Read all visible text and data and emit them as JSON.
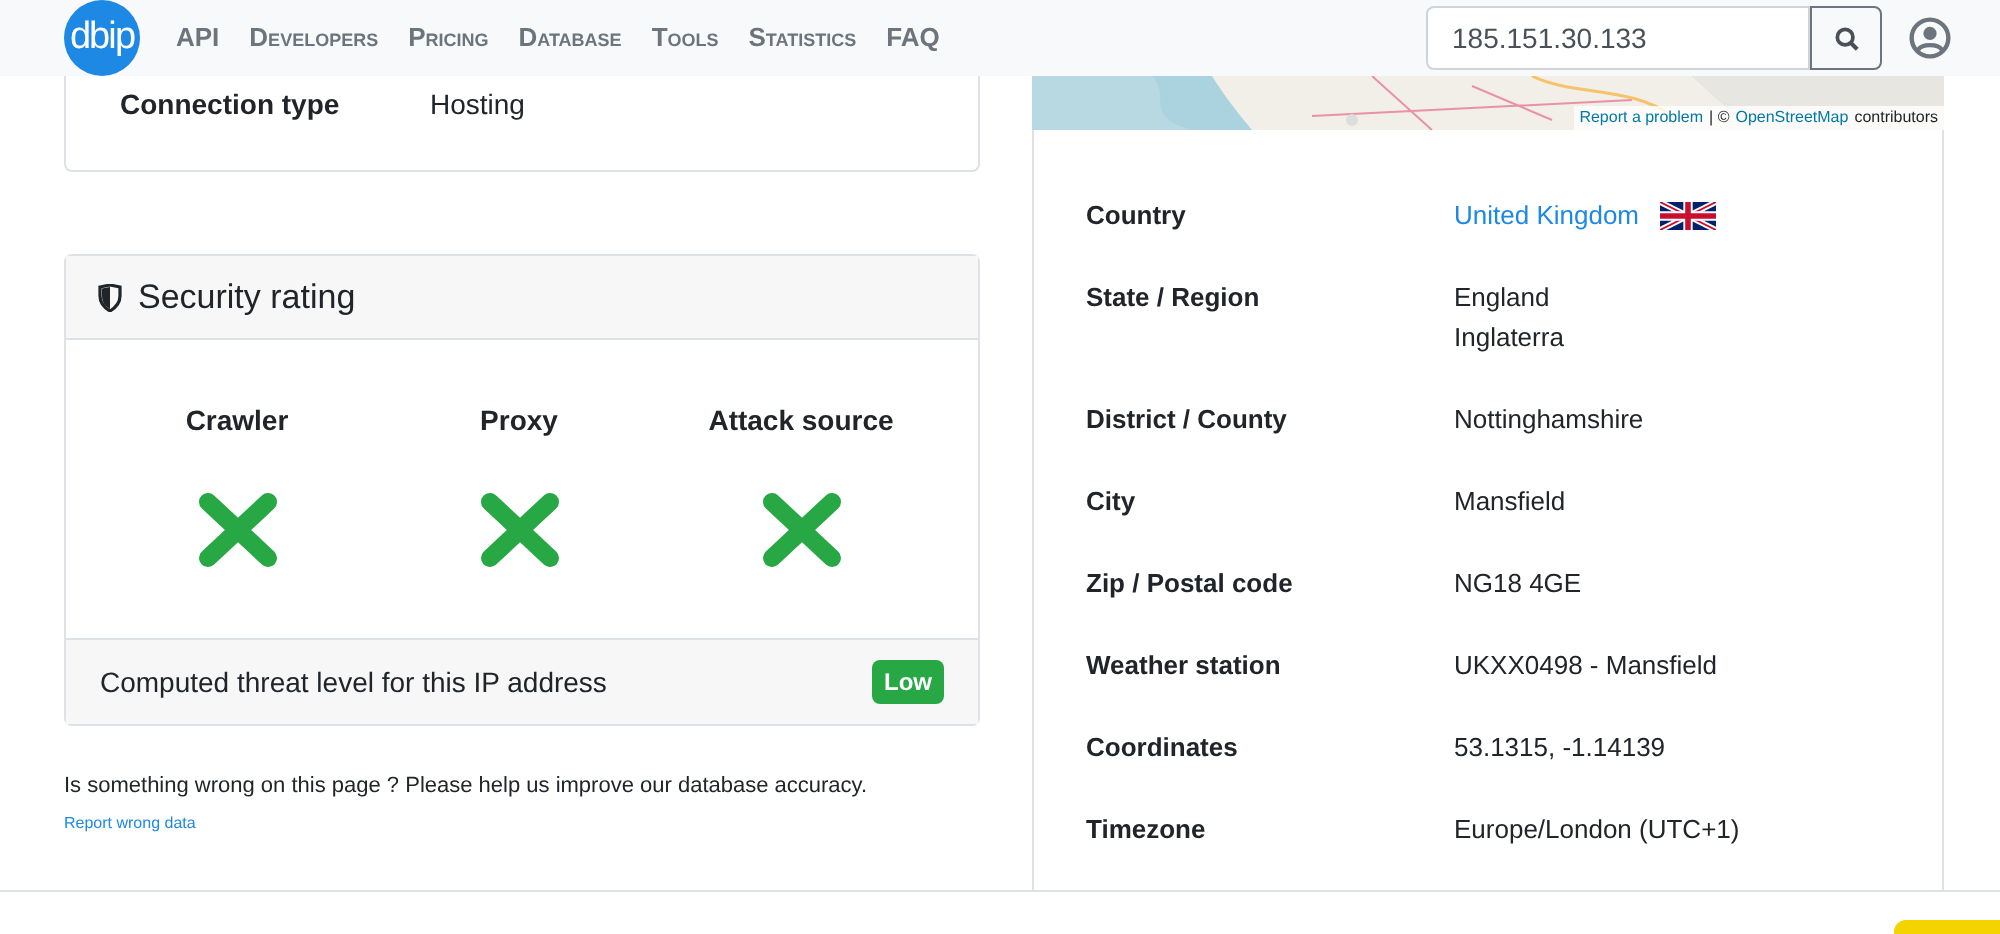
{
  "nav": {
    "logo": "dbip",
    "links": [
      "API",
      "Developers",
      "Pricing",
      "Database",
      "Tools",
      "Statistics",
      "FAQ"
    ],
    "search": {
      "value": "185.151.30.133"
    }
  },
  "connection": {
    "label": "Connection type",
    "value": "Hosting"
  },
  "security": {
    "title": "Security rating",
    "checks": [
      {
        "label": "Crawler",
        "flagged": false
      },
      {
        "label": "Proxy",
        "flagged": false
      },
      {
        "label": "Attack source",
        "flagged": false
      }
    ],
    "threat_text": "Computed threat level for this IP address",
    "threat_level": "Low"
  },
  "feedback": {
    "text": "Is something wrong on this page ? Please help us improve our database accuracy.",
    "link": "Report wrong data"
  },
  "map": {
    "kind": "picture",
    "attribution_link": "Report a problem",
    "attribution_sep": "| ©",
    "attribution_osm": "OpenStreetMap",
    "attribution_tail": "contributors"
  },
  "details": [
    {
      "label": "Country",
      "values": [
        "United Kingdom"
      ],
      "kind": "link_flag"
    },
    {
      "label": "State / Region",
      "values": [
        "England",
        "Inglaterra"
      ],
      "kind": "text"
    },
    {
      "label": "District / County",
      "values": [
        "Nottinghamshire"
      ],
      "kind": "text"
    },
    {
      "label": "City",
      "values": [
        "Mansfield"
      ],
      "kind": "text"
    },
    {
      "label": "Zip / Postal code",
      "values": [
        "NG18 4GE"
      ],
      "kind": "text"
    },
    {
      "label": "Weather station",
      "values": [
        "UKXX0498 - Mansfield"
      ],
      "kind": "text"
    },
    {
      "label": "Coordinates",
      "values": [
        "53.1315, -1.14139"
      ],
      "kind": "text"
    },
    {
      "label": "Timezone",
      "values": [
        "Europe/London (UTC+1)"
      ],
      "kind": "text"
    }
  ]
}
